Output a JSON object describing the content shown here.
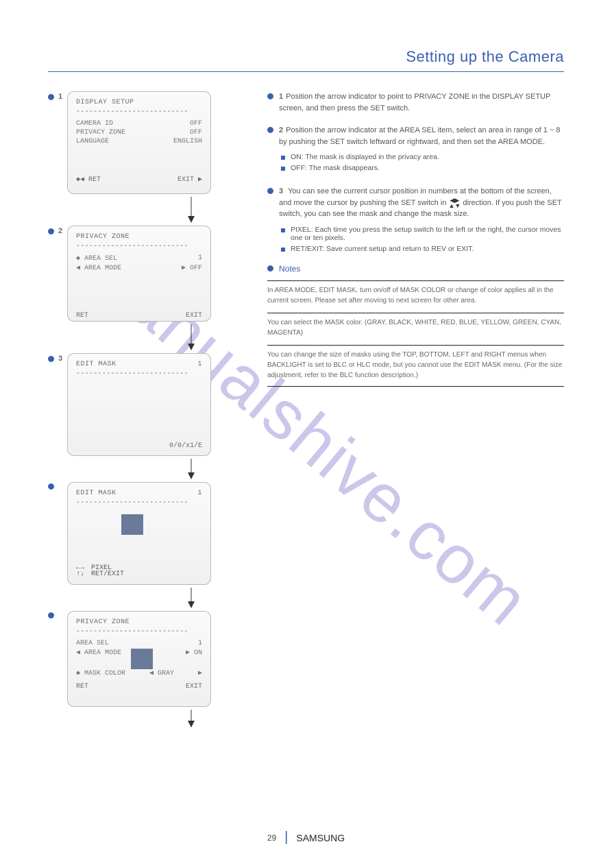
{
  "section_title": "Setting up the Camera",
  "watermark": "manualshive.com",
  "panels": {
    "p1": {
      "title": "DISPLAY SETUP",
      "dashes": "--------------------------",
      "r1_l": "CAMERA ID",
      "r1_v": "OFF",
      "r2_l": "PRIVACY ZONE",
      "r2_v": "OFF",
      "r3_l": "LANGUAGE",
      "r3_v": "ENGLISH",
      "nav_l": "◆◀  RET",
      "nav_r": "EXIT  ▶"
    },
    "p2": {
      "title": "PRIVACY ZONE",
      "dashes": "--------------------------",
      "r1_l": "◆ AREA SEL",
      "r1_v": "1",
      "r2_l": "◀  AREA MODE",
      "r2_r": "▶    OFF",
      "nav_l": "RET",
      "nav_r": "EXIT"
    },
    "p3": {
      "title": "EDIT MASK",
      "title_num": "1",
      "dashes": "--------------------------",
      "foot": "0/0/x1/E"
    },
    "p4": {
      "title": "EDIT MASK",
      "title_num": "1",
      "dashes": "--------------------------",
      "arrows_l": "←→\n↑↓",
      "arrows_r": "PIXEL\nRET/EXIT"
    },
    "p5": {
      "title": "PRIVACY ZONE",
      "dashes": "--------------------------",
      "r1_l": "AREA SEL",
      "r1_v": "1",
      "r2_l": "◀  AREA MODE",
      "r2_r": "▶    ON",
      "r3_l": "◆ MASK COLOR",
      "r3_l2": "◀  GRAY",
      "r3_r": "▶",
      "nav_l": "RET",
      "nav_r": "EXIT"
    }
  },
  "right": {
    "b1_num": "1",
    "b1": "Position the arrow indicator to point to PRIVACY ZONE in the DISPLAY SETUP screen, and then press the SET switch.",
    "b2_num": "2",
    "b2": "Position the arrow indicator at the AREA SEL item, select an area in range of 1 ~ 8 by pushing the SET switch leftward or rightward, and then set the AREA MODE.",
    "b2_s1": "ON: The mask is displayed in the privacy area.",
    "b2_s2": "OFF: The mask disappears.",
    "b3_num": "3",
    "b3a": "You can see the current cursor position in numbers at the bottom of the screen, and move the cursor by pushing the SET switch in",
    "b3b": "direction. If you push the SET switch, you can see the mask and change the mask size.",
    "b3_s1": "PIXEL: Each time you press the setup switch to the left or the right, the cursor moves one or ten pixels.",
    "b3_s2": "RET/EXIT: Save current setup and return to REV or EXIT.",
    "notes_head": "Notes",
    "n1": "In AREA MODE, EDIT MASK, turn on/off of MASK COLOR or change of color applies all in the current screen. Please set after moving to next screen for other area.",
    "n2": "You can select the MASK color. (GRAY, BLACK, WHITE, RED, BLUE, YELLOW, GREEN, CYAN, MAGENTA)",
    "n3": "You can change the size of masks using the TOP, BOTTOM, LEFT and RIGHT menus when BACKLIGHT is set to BLC or HLC mode, but you cannot use the EDIT MASK menu. (For the size adjustment, refer to the BLC function description.)"
  },
  "footer": {
    "page": "29",
    "label": "SAMSUNG"
  }
}
